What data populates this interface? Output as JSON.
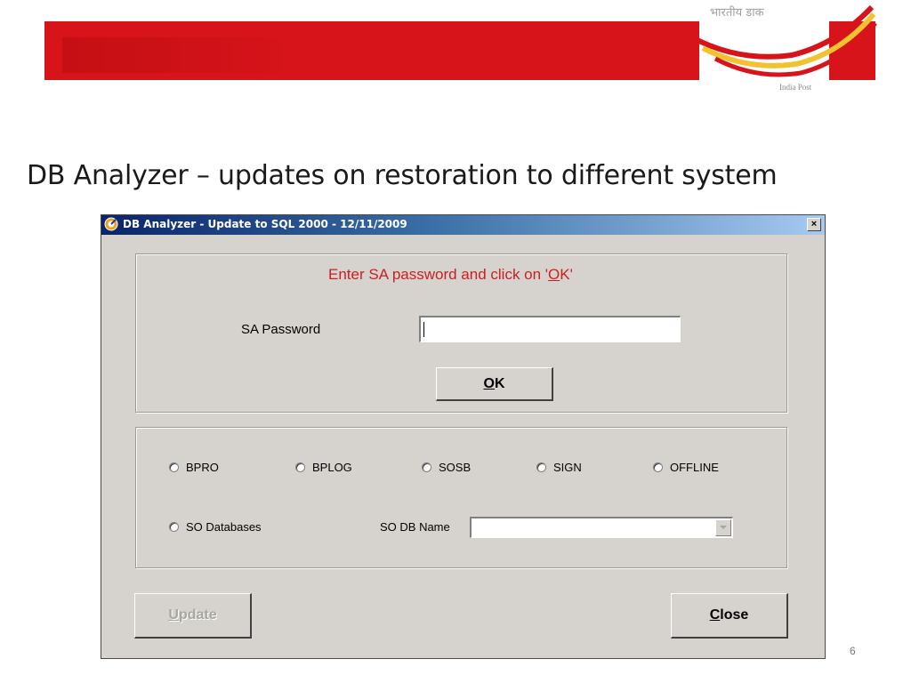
{
  "slide": {
    "logo_hindi": "भारतीय डाक",
    "logo_english": "India Post",
    "title": "DB Analyzer – updates on restoration to different system",
    "page_number": "6"
  },
  "dialog": {
    "title": "DB Analyzer - Update to SQL 2000 - 12/11/2009",
    "close_glyph": "×",
    "prompt_prefix": "Enter SA password and click on '",
    "prompt_key": "O",
    "prompt_suffix": "K'",
    "password_label": "SA Password",
    "password_value": "",
    "ok_key": "O",
    "ok_rest": "K",
    "radios": [
      "BPRO",
      "BPLOG",
      "SOSB",
      "SIGN",
      "OFFLINE",
      "SO Databases"
    ],
    "so_db_name_label": "SO DB Name",
    "so_db_name_value": "",
    "update_key": "U",
    "update_rest": "pdate",
    "close_key": "C",
    "close_rest": "lose"
  },
  "colors": {
    "banner": "#d7141a",
    "prompt_text": "#cc1f1f",
    "dialog_face": "#d6d3ce"
  }
}
